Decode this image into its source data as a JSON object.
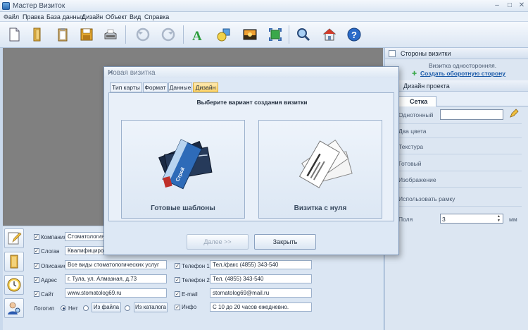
{
  "window": {
    "title": "Мастер Визиток"
  },
  "menu": [
    "Файл",
    "Правка",
    "База данных",
    "Дизайн",
    "Объект",
    "Вид",
    "Справка"
  ],
  "toolbar": {
    "icons": [
      "new-file-icon",
      "open-folder-icon",
      "clipboard-icon",
      "save-icon",
      "print-icon",
      "undo-icon",
      "redo-icon",
      "text-icon",
      "shapes-icon",
      "image-icon",
      "fit-icon",
      "zoom-icon",
      "home-icon",
      "help-icon"
    ]
  },
  "right_panel": {
    "sides_header": "Стороны визитки",
    "one_sided": "Визитка односторонняя.",
    "create_back_link": "Создать оборотную сторону",
    "design_header": "Дизайн проекта",
    "grid_tab": "Сетка",
    "options": [
      "Однотонный",
      "Два цвета",
      "Текстура",
      "Готовый",
      "Изображение"
    ],
    "use_frame": "Использовать рамку",
    "margins_label": "Поля",
    "margins_value": "3",
    "margins_unit": "мм"
  },
  "form": {
    "fields": [
      {
        "label": "Компания",
        "value": "Стоматология «"
      },
      {
        "label": "Слоган",
        "value": "Квалифицирован"
      },
      {
        "label": "Описание",
        "value": "Все виды стоматологических услуг"
      },
      {
        "label": "Адрес",
        "value": "г. Тула, ул. Алмазная, д.73"
      },
      {
        "label": "Сайт",
        "value": "www.stomatolog69.ru"
      }
    ],
    "right_fields": [
      {
        "label": "Телефон 1",
        "value": "Тел./факс (4855) 343-540"
      },
      {
        "label": "Телефон 2",
        "value": "Тел. (4855) 343-540"
      },
      {
        "label": "E-mail",
        "value": "stomatolog69@mail.ru"
      },
      {
        "label": "Инфо",
        "value": "С 10 до 20 часов ежедневно."
      }
    ],
    "logo_label": "Логотип",
    "logo_none": "Нет",
    "logo_from_file": "Из файла",
    "logo_from_catalog": "Из каталога"
  },
  "dialog": {
    "title": "Новая визитка",
    "tabs": [
      "Тип карты",
      "Формат",
      "Данные",
      "Дизайн"
    ],
    "active_tab": "Дизайн",
    "heading": "Выберите вариант создания визитки",
    "choice_templates": "Готовые шаблоны",
    "choice_scratch": "Визитка с нуля",
    "next_button": "Далее >>",
    "close_button": "Закрыть"
  }
}
